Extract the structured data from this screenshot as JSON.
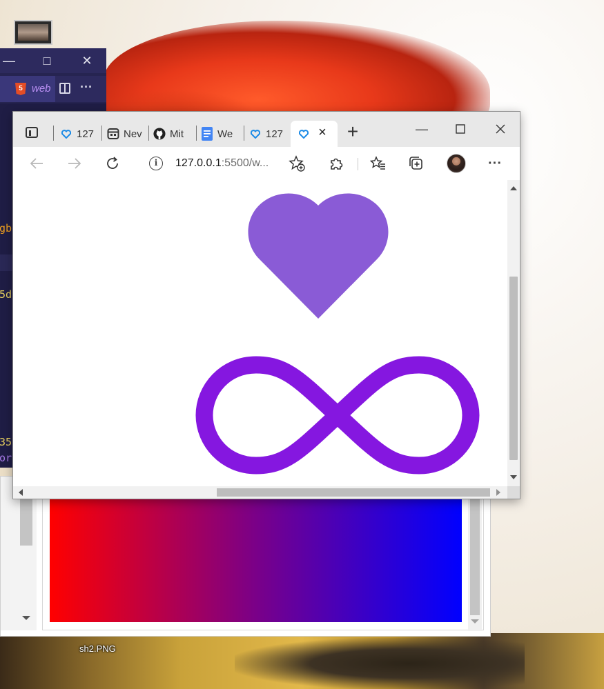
{
  "desktop": {
    "file_label": "sh2.PNG"
  },
  "vscode": {
    "tab_label": "web",
    "code_fragments": [
      "gb",
      "5d",
      "35",
      "ort"
    ],
    "colors": {
      "bg": "#1f1d45",
      "titlebar": "#2d2a5e",
      "tab_label": "#b98ff3"
    }
  },
  "browser": {
    "tabs": [
      {
        "label": "127",
        "icon": "heart-outline-icon"
      },
      {
        "label": "Nev",
        "icon": "calendar-app-icon"
      },
      {
        "label": "Mit",
        "icon": "github-icon"
      },
      {
        "label": "We",
        "icon": "docs-icon"
      },
      {
        "label": "127",
        "icon": "heart-outline-icon"
      },
      {
        "label": "",
        "icon": "heart-outline-icon",
        "active": true
      }
    ],
    "address": {
      "url_host": "127.0.0.1",
      "url_rest": ":5500/w..."
    },
    "colors": {
      "heart": "#8a5bd6",
      "infinity": "#8517e0"
    }
  },
  "preview": {
    "gradient_colors": [
      "#ff0000",
      "#7a0088",
      "#0000ff"
    ]
  }
}
